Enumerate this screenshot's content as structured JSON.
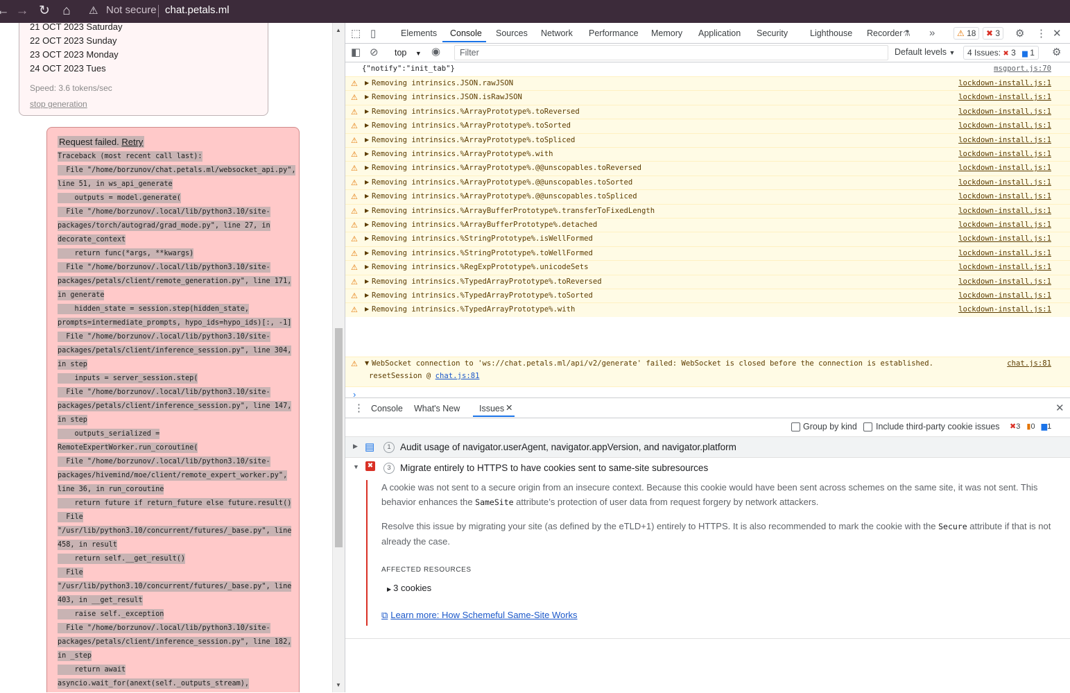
{
  "browser": {
    "security_label": "Not secure",
    "url": "chat.petals.ml"
  },
  "page": {
    "dates": [
      "21 OCT 2023 Saturday",
      "22 OCT 2023 Sunday",
      "23 OCT 2023 Monday",
      "24 OCT 2023 Tues"
    ],
    "speed": "Speed: 3.6 tokens/sec",
    "stop_link": "stop generation",
    "error_title": "Request failed.",
    "retry_link": "Retry",
    "traceback": [
      "Traceback (most recent call last):",
      "  File \"/home/borzunov/chat.petals.ml/websocket_api.py\",",
      "line 51, in ws_api_generate",
      "    outputs = model.generate(",
      "  File \"/home/borzunov/.local/lib/python3.10/site-",
      "packages/torch/autograd/grad_mode.py\", line 27, in",
      "decorate_context",
      "    return func(*args, **kwargs)",
      "  File \"/home/borzunov/.local/lib/python3.10/site-",
      "packages/petals/client/remote_generation.py\", line 171,",
      "in generate",
      "    hidden_state = session.step(hidden_state,",
      "prompts=intermediate_prompts, hypo_ids=hypo_ids)[:, -1]",
      "  File \"/home/borzunov/.local/lib/python3.10/site-",
      "packages/petals/client/inference_session.py\", line 304,",
      "in step",
      "    inputs = server_session.step(",
      "  File \"/home/borzunov/.local/lib/python3.10/site-",
      "packages/petals/client/inference_session.py\", line 147,",
      "in step",
      "    outputs_serialized =",
      "RemoteExpertWorker.run_coroutine(",
      "  File \"/home/borzunov/.local/lib/python3.10/site-",
      "packages/hivemind/moe/client/remote_expert_worker.py\",",
      "line 36, in run_coroutine",
      "    return future if return_future else future.result()",
      "  File",
      "\"/usr/lib/python3.10/concurrent/futures/_base.py\", line",
      "458, in result",
      "    return self.__get_result()",
      "  File",
      "\"/usr/lib/python3.10/concurrent/futures/_base.py\", line",
      "403, in __get_result",
      "    raise self._exception",
      "  File \"/home/borzunov/.local/lib/python3.10/site-",
      "packages/petals/client/inference_session.py\", line 182,",
      "in _step",
      "    return await",
      "asyncio.wait_for(anext(self._outputs_stream),"
    ]
  },
  "devtools": {
    "tabs": [
      "Elements",
      "Console",
      "Sources",
      "Network",
      "Performance",
      "Memory",
      "Application",
      "Security",
      "Lighthouse",
      "Recorder"
    ],
    "warnings_count": "18",
    "errors_count": "3",
    "context": "top",
    "filter_placeholder": "Filter",
    "levels": "Default levels",
    "issues_label": "4 Issues:",
    "issues_errors": "3",
    "issues_info": "1",
    "first_log": {
      "msg": "{\"notify\":\"init_tab\"}",
      "src": "msgport.js:70"
    },
    "warnings": [
      {
        "msg": "Removing intrinsics.JSON.rawJSON",
        "src": "lockdown-install.js:1"
      },
      {
        "msg": "Removing intrinsics.JSON.isRawJSON",
        "src": "lockdown-install.js:1"
      },
      {
        "msg": "Removing intrinsics.%ArrayPrototype%.toReversed",
        "src": "lockdown-install.js:1"
      },
      {
        "msg": "Removing intrinsics.%ArrayPrototype%.toSorted",
        "src": "lockdown-install.js:1"
      },
      {
        "msg": "Removing intrinsics.%ArrayPrototype%.toSpliced",
        "src": "lockdown-install.js:1"
      },
      {
        "msg": "Removing intrinsics.%ArrayPrototype%.with",
        "src": "lockdown-install.js:1"
      },
      {
        "msg": "Removing intrinsics.%ArrayPrototype%.@@unscopables.toReversed",
        "src": "lockdown-install.js:1"
      },
      {
        "msg": "Removing intrinsics.%ArrayPrototype%.@@unscopables.toSorted",
        "src": "lockdown-install.js:1"
      },
      {
        "msg": "Removing intrinsics.%ArrayPrototype%.@@unscopables.toSpliced",
        "src": "lockdown-install.js:1"
      },
      {
        "msg": "Removing intrinsics.%ArrayBufferPrototype%.transferToFixedLength",
        "src": "lockdown-install.js:1"
      },
      {
        "msg": "Removing intrinsics.%ArrayBufferPrototype%.detached",
        "src": "lockdown-install.js:1"
      },
      {
        "msg": "Removing intrinsics.%StringPrototype%.isWellFormed",
        "src": "lockdown-install.js:1"
      },
      {
        "msg": "Removing intrinsics.%StringPrototype%.toWellFormed",
        "src": "lockdown-install.js:1"
      },
      {
        "msg": "Removing intrinsics.%RegExpPrototype%.unicodeSets",
        "src": "lockdown-install.js:1"
      },
      {
        "msg": "Removing intrinsics.%TypedArrayPrototype%.toReversed",
        "src": "lockdown-install.js:1"
      },
      {
        "msg": "Removing intrinsics.%TypedArrayPrototype%.toSorted",
        "src": "lockdown-install.js:1"
      },
      {
        "msg": "Removing intrinsics.%TypedArrayPrototype%.with",
        "src": "lockdown-install.js:1"
      }
    ],
    "ws_error": {
      "msg": "WebSocket connection to 'ws://chat.petals.ml/api/v2/generate' failed: WebSocket is closed before the connection is established.",
      "stack_fn": "resetSession @ ",
      "stack_link": "chat.js:81",
      "src": "chat.js:81"
    },
    "drawer": {
      "tabs": [
        "Console",
        "What's New",
        "Issues"
      ],
      "group_by_kind": "Group by kind",
      "third_party": "Include third-party cookie issues",
      "count_errors": "3",
      "count_warnings": "0",
      "count_info": "1",
      "issue1_count": "1",
      "issue1_title": "Audit usage of navigator.userAgent, navigator.appVersion, and navigator.platform",
      "issue2_count": "3",
      "issue2_title": "Migrate entirely to HTTPS to have cookies sent to same-site subresources",
      "p1a": "A cookie was not sent to a secure origin from an insecure context. Because this cookie would have been sent across schemes on the same site, it was not sent. This behavior enhances the ",
      "p1_code": "SameSite",
      "p1b": " attribute’s protection of user data from request forgery by network attackers.",
      "p2a": "Resolve this issue by migrating your site (as defined by the eTLD+1) entirely to HTTPS. It is also recommended to mark the cookie with the ",
      "p2_code": "Secure",
      "p2b": " attribute if that is not already the case.",
      "affected": "AFFECTED RESOURCES",
      "cookies": "3 cookies",
      "learn_more": "Learn more: How Schemeful Same-Site Works"
    }
  }
}
